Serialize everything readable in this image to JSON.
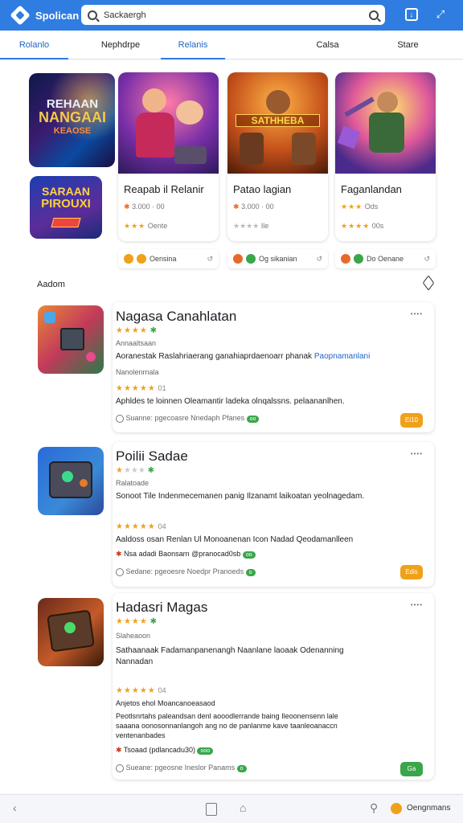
{
  "app": {
    "name": "Spolican"
  },
  "search": {
    "placeholder": "Sackaergh",
    "value": "Sackaergh"
  },
  "tabs": [
    "Rolanlo",
    "Nephdrpe",
    "Relanis",
    "Calsa",
    "Stare"
  ],
  "featured_tiles": [
    {
      "line1": "REHAAN",
      "line2": "NANGAAI",
      "line3": "KEAOSE"
    },
    {
      "line1": "SARAAN",
      "line2": "PIROUXI",
      "line3": ""
    }
  ],
  "featured_cards": [
    {
      "title": "Reapab il Relanir",
      "art_text": "",
      "meta1": "3.000 · 00",
      "meta2_stars": "★★★",
      "meta2": "Oente",
      "chip": "Oensina"
    },
    {
      "title": "Patao lagian",
      "art_text": "SATHHEBA",
      "meta1": "3.000 · 00",
      "meta2_stars": "★★★★",
      "meta2": "Ile",
      "chip": "Og sikanian"
    },
    {
      "title": "Faganlandan",
      "art_text": "",
      "meta1": "Ods",
      "meta2_stars": "★★★★",
      "meta2": "00s",
      "chip": "Do Oenane"
    }
  ],
  "section": {
    "label": "Aadom"
  },
  "list_items": [
    {
      "title": "Nagasa Canahlatan",
      "rating_stars": "★★★★",
      "sub1": "Annaaltsaan",
      "desc": "Aoranestak Raslahriaerang ganahiaprdaenoarr phanak",
      "link": "Paopnamanlani",
      "meta": "Nanolenrnala",
      "stars2": "★★★★★",
      "stars2_num": "01",
      "summary": "Aphldes te loinnen Oleamantir ladeka olnqalssns. pelaananlhen.",
      "footer": "Suanne: pgecoasre Nnedaph Pfanes",
      "badge": "Ei10",
      "badge_color": "#f0a11a"
    },
    {
      "title": "Poilii Sadae",
      "rating_stars": "★",
      "sub1": "Ralatoade",
      "desc": "Sonoot Tile Indenmecemanen panig Ilzanamt laikoatan yeolnagedam.",
      "link": "",
      "meta": "",
      "stars2": "★★★★★",
      "stars2_num": "04",
      "summary": "Aaldoss osan Renlan Ul Monoanenan Icon Nadad Qeodamanlleen",
      "line2": "Nsa adadi  Baonsarn  @pranocad0sb",
      "footer": "Sedane: pgeoesre Noedpr Pranoeds",
      "badge": "Edis",
      "badge_color": "#f0a11a"
    },
    {
      "title": "Hadasri Magas",
      "rating_stars": "★★★★",
      "sub1": "Slaheaoon",
      "desc": "Sathaanaak Fadamanpanenangh Naanlane laoaak Odenanning",
      "desc2": "Nannadan",
      "link": "",
      "meta": "",
      "stars2": "★★★★★",
      "stars2_num": "04",
      "summary": "Anjetos  ehol Moancanoeasaod",
      "para1": "Peotlsnrtahs paleandsan denl aooodlerrande baing Ileoonensenn lale",
      "para2": "saaana oonosonnanlangoh ang no de panlanme kave taanleoanaccn",
      "para3": "ventenanbades",
      "line2": "Tsoaad  (pdlancadu30)",
      "footer": "Sueane: pgeosne Ineslor Panams",
      "badge": "Ga",
      "badge_color": "#3aa64a"
    }
  ],
  "bottom": {
    "right_label": "Oengnmans"
  }
}
